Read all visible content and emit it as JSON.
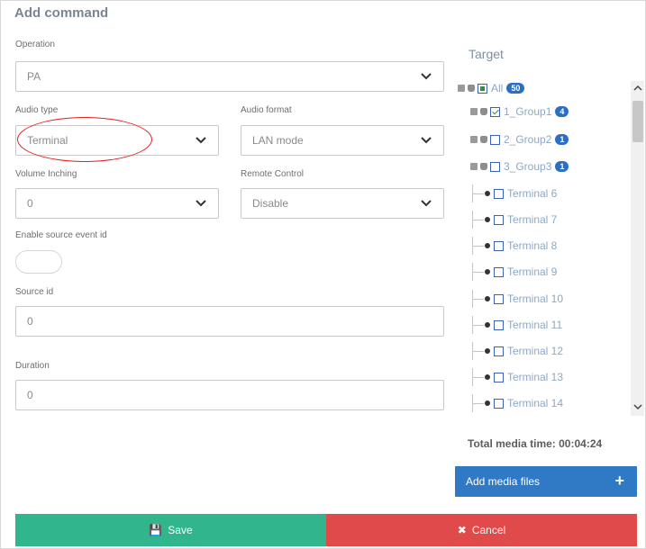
{
  "dialog": {
    "title": "Add command"
  },
  "form": {
    "operation": {
      "label": "Operation",
      "value": "PA"
    },
    "audio_type": {
      "label": "Audio type",
      "value": "Terminal"
    },
    "audio_format": {
      "label": "Audio format",
      "value": "LAN mode"
    },
    "volume_inching": {
      "label": "Volume Inching",
      "value": "0"
    },
    "remote_control": {
      "label": "Remote Control",
      "value": "Disable"
    },
    "enable_source_event_id": {
      "label": "Enable source event id",
      "enabled": false
    },
    "source_id": {
      "label": "Source id",
      "value": "0"
    },
    "duration": {
      "label": "Duration",
      "value": "0"
    }
  },
  "target": {
    "title": "Target",
    "items": [
      {
        "label": "All",
        "badge": "50",
        "type": "root",
        "state": "partial"
      },
      {
        "label": "1_Group1",
        "badge": "4",
        "type": "group",
        "state": "checked"
      },
      {
        "label": "2_Group2",
        "badge": "1",
        "type": "group",
        "state": "unchecked"
      },
      {
        "label": "3_Group3",
        "badge": "1",
        "type": "group",
        "state": "unchecked"
      },
      {
        "label": "Terminal 6",
        "type": "terminal",
        "state": "unchecked"
      },
      {
        "label": "Terminal 7",
        "type": "terminal",
        "state": "unchecked"
      },
      {
        "label": "Terminal 8",
        "type": "terminal",
        "state": "unchecked"
      },
      {
        "label": "Terminal 9",
        "type": "terminal",
        "state": "unchecked"
      },
      {
        "label": "Terminal 10",
        "type": "terminal",
        "state": "unchecked"
      },
      {
        "label": "Terminal 11",
        "type": "terminal",
        "state": "unchecked"
      },
      {
        "label": "Terminal 12",
        "type": "terminal",
        "state": "unchecked"
      },
      {
        "label": "Terminal 13",
        "type": "terminal",
        "state": "unchecked"
      },
      {
        "label": "Terminal 14",
        "type": "terminal",
        "state": "unchecked"
      }
    ]
  },
  "media": {
    "total_time": "Total media time: 00:04:24",
    "add_media_label": "Add media files",
    "add_icon": "plus-icon"
  },
  "actions": {
    "save_label": "Save",
    "save_icon": "floppy-disk-icon",
    "cancel_label": "Cancel",
    "cancel_icon": "x-icon"
  },
  "colors": {
    "save": "#30b58c",
    "cancel": "#e04a4a",
    "primary": "#2f79c5",
    "annotation": "#e02020"
  }
}
